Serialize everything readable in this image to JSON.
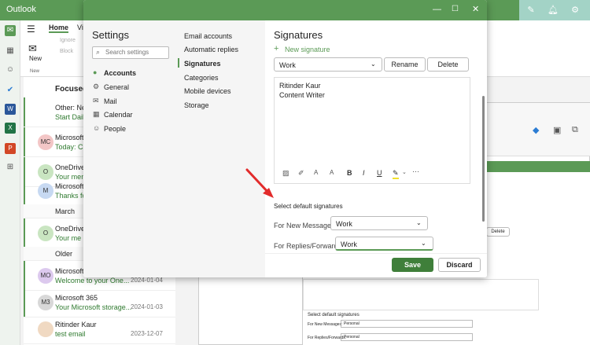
{
  "app": {
    "title": "Outlook"
  },
  "ribbon": {
    "tab_home": "Home",
    "tab_view": "Vi",
    "new_label": "New",
    "new_group": "New",
    "ignore": "Ignore",
    "block": "Block"
  },
  "msglist": {
    "focused": "Focused",
    "rows": [
      {
        "from": "Other: New",
        "subject": "Start Daily",
        "initials": "",
        "date": "",
        "color": "#ffffff"
      },
      {
        "from": "Microsoft",
        "subject": "Today: Cat",
        "initials": "MC",
        "date": "",
        "color": "#f3c6c6"
      },
      {
        "from": "OneDrive",
        "subject": "Your mem",
        "initials": "O",
        "date": "",
        "color": "#c9e5c1"
      },
      {
        "from": "Microsoft",
        "subject": "Thanks fo",
        "initials": "M",
        "date": "",
        "color": "#c7d9f2"
      },
      {
        "from": "OneDrive",
        "subject": "Your me",
        "initials": "O",
        "date": "",
        "color": "#c9e5c1"
      },
      {
        "from": "Microsoft",
        "subject": "Welcome to your One...",
        "initials": "MO",
        "date": "2024-01-04",
        "color": "#dcc9ee"
      },
      {
        "from": "Microsoft 365",
        "subject": "Your Microsoft storage...",
        "initials": "M3",
        "date": "2024-01-03",
        "color": "#d8d8d8"
      },
      {
        "from": "Ritinder Kaur",
        "subject": "test email",
        "initials": "",
        "date": "2023-12-07",
        "color": "#f0d9c2"
      }
    ],
    "section_march": "March",
    "section_older": "Older"
  },
  "settings": {
    "title": "Settings",
    "search_placeholder": "Search settings",
    "nav": [
      "Accounts",
      "General",
      "Mail",
      "Calendar",
      "People"
    ],
    "subnav": [
      "Email accounts",
      "Automatic replies",
      "Signatures",
      "Categories",
      "Mobile devices",
      "Storage"
    ],
    "panel": {
      "heading": "Signatures",
      "new_signature": "New signature",
      "selected_signature": "Work",
      "rename": "Rename",
      "delete": "Delete",
      "body_line1": "Ritinder Kaur",
      "body_line2": "Content Writer",
      "default_heading": "Select default signatures",
      "new_messages_label": "For New Messages:",
      "new_messages_value": "Work",
      "replies_label": "For Replies/Forwards:",
      "replies_value": "Work",
      "save": "Save",
      "discard": "Discard"
    }
  },
  "bg": {
    "delete": "Delete",
    "default_heading": "Select default signatures",
    "new_messages_label": "For New Messages:",
    "new_messages_value": "Personal",
    "replies_label": "For Replies/Forwards:",
    "replies_value": "Personal"
  },
  "colors": {
    "accent": "#5b9a56",
    "save": "#3f7f3a",
    "arrow": "#e22b2b"
  }
}
